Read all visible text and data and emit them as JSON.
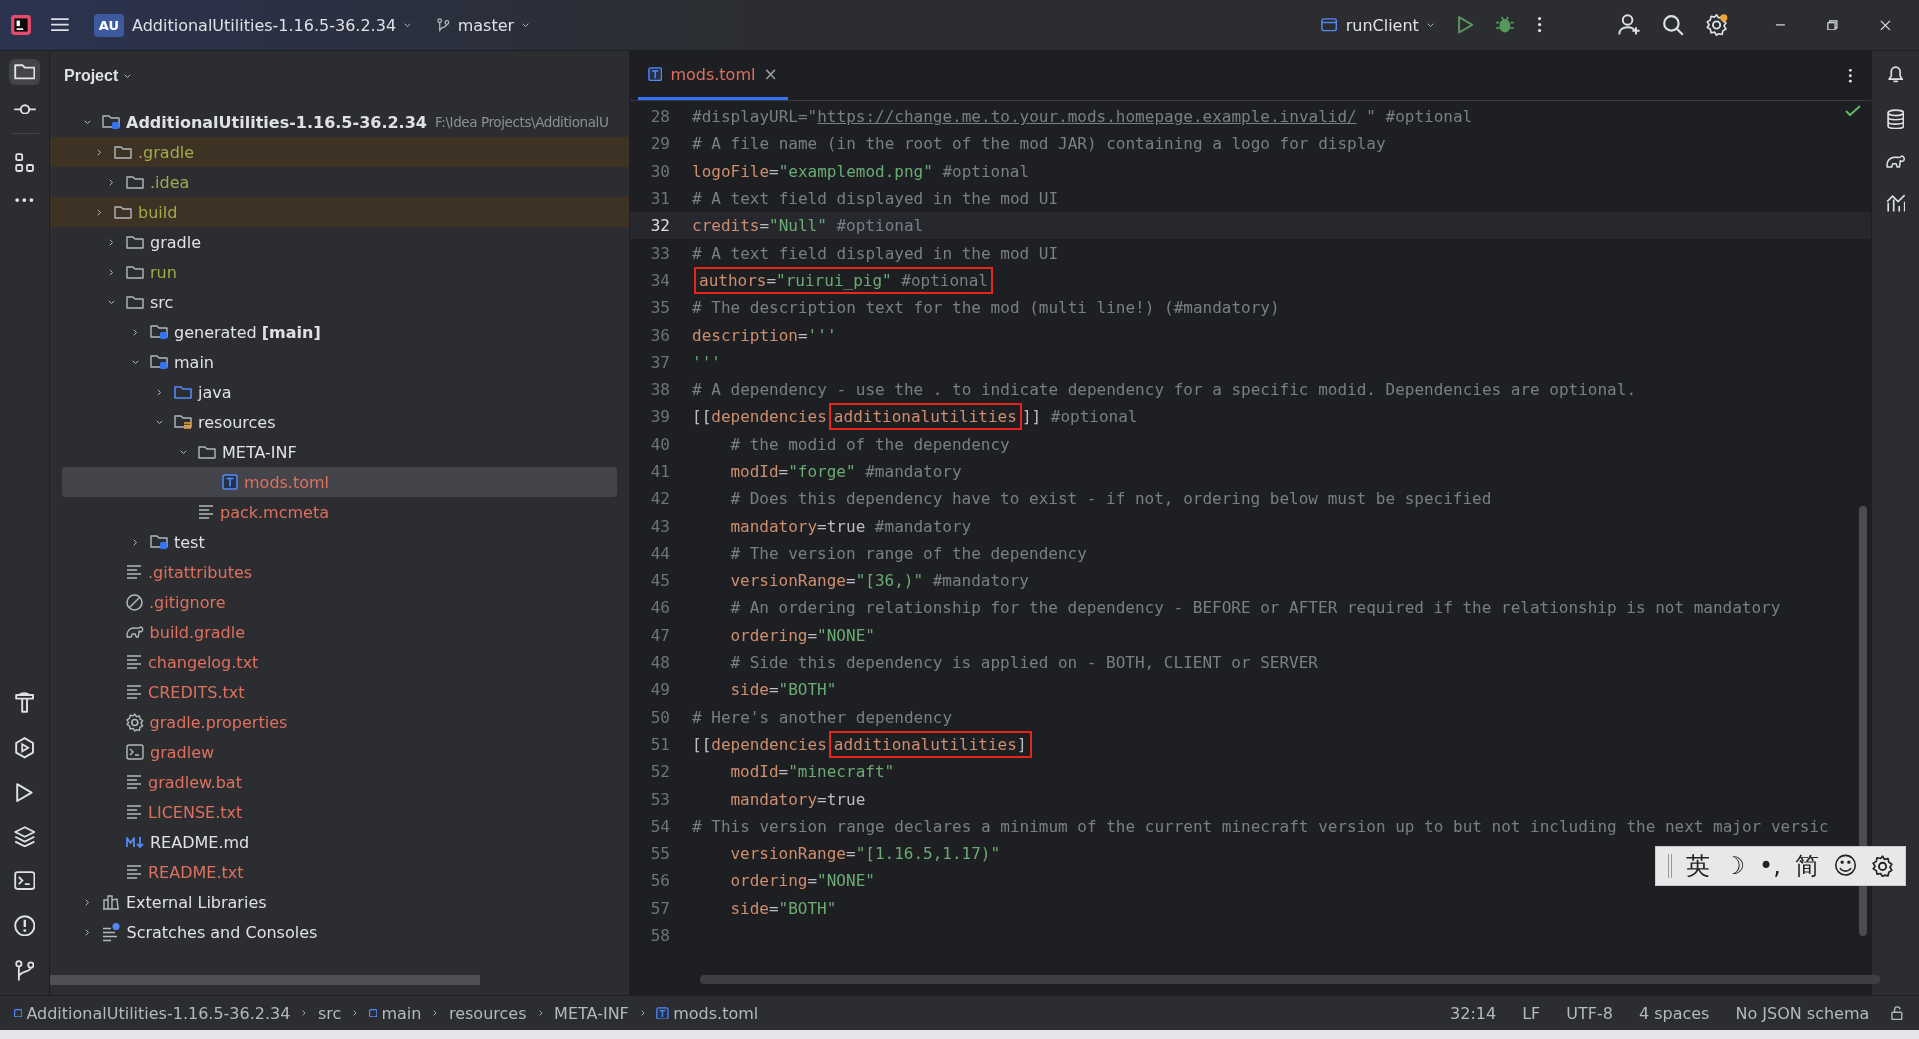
{
  "title_bar": {
    "project_badge": "AU",
    "project": "AdditionalUtilities-1.16.5-36.2.34",
    "branch": "master",
    "run_config": "runClient"
  },
  "project_panel": {
    "title": "Project",
    "tree": [
      {
        "name": "AdditionalUtilities-1.16.5-36.2.34",
        "path": "F:\\Idea Projects\\AdditionalU",
        "kind": "module",
        "color": "#dfe1e5",
        "excluded": false,
        "expanded": true,
        "selected": false,
        "children": [
          {
            "name": ".gradle",
            "kind": "folder",
            "color": "#a4a94b",
            "excluded": true,
            "expanded": false,
            "selected": false
          },
          {
            "name": ".idea",
            "kind": "folder",
            "color": "#a4a94b",
            "excluded": false,
            "expanded": false,
            "selected": false
          },
          {
            "name": "build",
            "kind": "folder",
            "color": "#a4a94b",
            "excluded": true,
            "expanded": false,
            "selected": false
          },
          {
            "name": "gradle",
            "kind": "folder",
            "color": "#dfe1e5",
            "excluded": false,
            "expanded": false,
            "selected": false
          },
          {
            "name": "run",
            "kind": "folder",
            "color": "#a4a94b",
            "excluded": false,
            "expanded": false,
            "selected": false
          },
          {
            "name": "src",
            "kind": "folder",
            "color": "#dfe1e5",
            "excluded": false,
            "expanded": true,
            "selected": false,
            "children": [
              {
                "name": "generated **[main]**",
                "kind": "module",
                "color": "#dfe1e5",
                "excluded": false,
                "expanded": false,
                "selected": false
              },
              {
                "name": "main",
                "kind": "module",
                "color": "#dfe1e5",
                "excluded": false,
                "expanded": true,
                "selected": false,
                "children": [
                  {
                    "name": "java",
                    "kind": "source",
                    "color": "#dfe1e5",
                    "excluded": false,
                    "expanded": false,
                    "selected": false
                  },
                  {
                    "name": "resources",
                    "kind": "resources",
                    "color": "#dfe1e5",
                    "excluded": false,
                    "expanded": true,
                    "selected": false,
                    "children": [
                      {
                        "name": "META-INF",
                        "kind": "folder",
                        "color": "#dfe1e5",
                        "excluded": false,
                        "expanded": true,
                        "selected": false,
                        "children": [
                          {
                            "name": "mods.toml",
                            "kind": "toml",
                            "color": "#e0705e",
                            "excluded": false,
                            "selected": true
                          }
                        ]
                      },
                      {
                        "name": "pack.mcmeta",
                        "kind": "text",
                        "color": "#e0705e",
                        "excluded": false,
                        "selected": false
                      }
                    ]
                  }
                ]
              },
              {
                "name": "test",
                "kind": "module",
                "color": "#dfe1e5",
                "excluded": false,
                "expanded": false,
                "selected": false
              }
            ]
          },
          {
            "name": ".gitattributes",
            "kind": "text",
            "color": "#e0705e",
            "excluded": false,
            "selected": false
          },
          {
            "name": ".gitignore",
            "kind": "ignore",
            "color": "#e0705e",
            "excluded": false,
            "selected": false
          },
          {
            "name": "build.gradle",
            "kind": "elephant",
            "color": "#e0705e",
            "excluded": false,
            "selected": false
          },
          {
            "name": "changelog.txt",
            "kind": "text",
            "color": "#e0705e",
            "excluded": false,
            "selected": false
          },
          {
            "name": "CREDITS.txt",
            "kind": "text",
            "color": "#e0705e",
            "excluded": false,
            "selected": false
          },
          {
            "name": "gradle.properties",
            "kind": "gear",
            "color": "#e0705e",
            "excluded": false,
            "selected": false
          },
          {
            "name": "gradlew",
            "kind": "terminal",
            "color": "#e0705e",
            "excluded": false,
            "selected": false
          },
          {
            "name": "gradlew.bat",
            "kind": "text",
            "color": "#e0705e",
            "excluded": false,
            "selected": false
          },
          {
            "name": "LICENSE.txt",
            "kind": "text",
            "color": "#e0705e",
            "excluded": false,
            "selected": false
          },
          {
            "name": "README.md",
            "kind": "markdown",
            "color": "#dfe1e5",
            "excluded": false,
            "selected": false
          },
          {
            "name": "README.txt",
            "kind": "text",
            "color": "#e0705e",
            "excluded": false,
            "selected": false
          }
        ]
      },
      {
        "name": "External Libraries",
        "kind": "library",
        "color": "#dfe1e5",
        "excluded": false,
        "expanded": false,
        "selected": false
      },
      {
        "name": "Scratches and Consoles",
        "kind": "scratch",
        "color": "#dfe1e5",
        "excluded": false,
        "expanded": false,
        "selected": false
      }
    ]
  },
  "editor": {
    "tabs": [
      {
        "label": "mods.toml",
        "close": "×",
        "selected": true
      }
    ],
    "lines": [
      {
        "number": "28",
        "current": false,
        "indented": false,
        "tokens": [
          {
            "kind": "comment",
            "text": "#displayURL=\""
          },
          {
            "kind": "link",
            "text": "https://change.me.to.your.mods.homepage.example.invalid/"
          },
          {
            "kind": "comment",
            "text": "\" #optional"
          }
        ]
      },
      {
        "number": "29",
        "current": false,
        "indented": false,
        "tokens": [
          {
            "kind": "comment",
            "text": "# A file name (in the root of the mod JAR) containing a logo for display"
          }
        ]
      },
      {
        "number": "30",
        "current": false,
        "indented": false,
        "tokens": [
          {
            "kind": "key",
            "text": "logoFile"
          },
          {
            "kind": "plain",
            "text": "="
          },
          {
            "kind": "string",
            "text": "\"examplemod.png\""
          },
          {
            "kind": "comment",
            "text": "#optional"
          }
        ]
      },
      {
        "number": "31",
        "current": false,
        "indented": false,
        "tokens": [
          {
            "kind": "comment",
            "text": "# A text field displayed in the mod UI"
          }
        ]
      },
      {
        "number": "32",
        "current": true,
        "indented": false,
        "tokens": [
          {
            "kind": "key",
            "text": "credits"
          },
          {
            "kind": "plain",
            "text": "="
          },
          {
            "kind": "string",
            "text": "\"Null\""
          },
          {
            "kind": "comment",
            "text": "#optional"
          }
        ]
      },
      {
        "number": "33",
        "current": false,
        "indented": false,
        "tokens": [
          {
            "kind": "comment",
            "text": "# A text field displayed in the mod UI"
          }
        ]
      },
      {
        "number": "34",
        "current": false,
        "indented": false,
        "tokens": [
          {
            "kind": "box",
            "tokens": [
              {
                "kind": "key",
                "text": "authors"
              },
              {
                "kind": "plain",
                "text": "="
              },
              {
                "kind": "string",
                "text": "\"ruirui_pig\""
              },
              {
                "kind": "comment",
                "text": "#optional"
              }
            ]
          }
        ]
      },
      {
        "number": "35",
        "current": false,
        "indented": false,
        "tokens": [
          {
            "kind": "comment",
            "text": "# The description text for the mod (multi line!) (#mandatory)"
          }
        ]
      },
      {
        "number": "36",
        "current": false,
        "indented": false,
        "tokens": [
          {
            "kind": "key",
            "text": "description"
          },
          {
            "kind": "plain",
            "text": "="
          },
          {
            "kind": "string",
            "text": "'''"
          }
        ]
      },
      {
        "number": "37",
        "current": false,
        "indented": false,
        "tokens": [
          {
            "kind": "string",
            "text": "'''"
          }
        ]
      },
      {
        "number": "38",
        "current": false,
        "indented": false,
        "tokens": [
          {
            "kind": "comment",
            "text": "# A dependency - use the . to indicate dependency for a specific modid. Dependencies are optional."
          }
        ]
      },
      {
        "number": "39",
        "current": false,
        "indented": false,
        "tokens": [
          {
            "kind": "plain",
            "text": "[["
          },
          {
            "kind": "key",
            "text": "dependencies"
          },
          {
            "kind": "box",
            "tokens": [
              {
                "kind": "key",
                "text": "additionalutilities"
              }
            ]
          },
          {
            "kind": "plain",
            "text": "]]"
          },
          {
            "kind": "comment",
            "text": "#optional"
          }
        ]
      },
      {
        "number": "40",
        "current": false,
        "indented": true,
        "tokens": [
          {
            "kind": "comment",
            "text": "# the modid of the dependency"
          }
        ]
      },
      {
        "number": "41",
        "current": false,
        "indented": true,
        "tokens": [
          {
            "kind": "key",
            "text": "modId"
          },
          {
            "kind": "plain",
            "text": "="
          },
          {
            "kind": "string",
            "text": "\"forge\""
          },
          {
            "kind": "comment",
            "text": "#mandatory"
          }
        ]
      },
      {
        "number": "42",
        "current": false,
        "indented": true,
        "tokens": [
          {
            "kind": "comment",
            "text": "# Does this dependency have to exist - if not, ordering below must be specified"
          }
        ]
      },
      {
        "number": "43",
        "current": false,
        "indented": true,
        "tokens": [
          {
            "kind": "key",
            "text": "mandatory"
          },
          {
            "kind": "plain",
            "text": "=true"
          },
          {
            "kind": "comment",
            "text": "#mandatory"
          }
        ]
      },
      {
        "number": "44",
        "current": false,
        "indented": true,
        "tokens": [
          {
            "kind": "comment",
            "text": "# The version range of the dependency"
          }
        ]
      },
      {
        "number": "45",
        "current": false,
        "indented": true,
        "tokens": [
          {
            "kind": "key",
            "text": "versionRange"
          },
          {
            "kind": "plain",
            "text": "="
          },
          {
            "kind": "string",
            "text": "\"[36,)\""
          },
          {
            "kind": "comment",
            "text": "#mandatory"
          }
        ]
      },
      {
        "number": "46",
        "current": false,
        "indented": true,
        "tokens": [
          {
            "kind": "comment",
            "text": "# An ordering relationship for the dependency - BEFORE or AFTER required if the relationship is not mandatory"
          }
        ]
      },
      {
        "number": "47",
        "current": false,
        "indented": true,
        "tokens": [
          {
            "kind": "key",
            "text": "ordering"
          },
          {
            "kind": "plain",
            "text": "="
          },
          {
            "kind": "string",
            "text": "\"NONE\""
          }
        ]
      },
      {
        "number": "48",
        "current": false,
        "indented": true,
        "tokens": [
          {
            "kind": "comment",
            "text": "# Side this dependency is applied on - BOTH, CLIENT or SERVER"
          }
        ]
      },
      {
        "number": "49",
        "current": false,
        "indented": true,
        "tokens": [
          {
            "kind": "key",
            "text": "side"
          },
          {
            "kind": "plain",
            "text": "="
          },
          {
            "kind": "string",
            "text": "\"BOTH\""
          }
        ]
      },
      {
        "number": "50",
        "current": false,
        "indented": false,
        "tokens": [
          {
            "kind": "comment",
            "text": "# Here's another dependency"
          }
        ]
      },
      {
        "number": "51",
        "current": false,
        "indented": false,
        "tokens": [
          {
            "kind": "plain",
            "text": "[["
          },
          {
            "kind": "key",
            "text": "dependencies"
          },
          {
            "kind": "box",
            "tokens": [
              {
                "kind": "key",
                "text": "additionalutilities"
              },
              {
                "kind": "plain",
                "text": "]"
              }
            ]
          }
        ]
      },
      {
        "number": "52",
        "current": false,
        "indented": true,
        "tokens": [
          {
            "kind": "key",
            "text": "modId"
          },
          {
            "kind": "plain",
            "text": "="
          },
          {
            "kind": "string",
            "text": "\"minecraft\""
          }
        ]
      },
      {
        "number": "53",
        "current": false,
        "indented": true,
        "tokens": [
          {
            "kind": "key",
            "text": "mandatory"
          },
          {
            "kind": "plain",
            "text": "=true"
          }
        ]
      },
      {
        "number": "54",
        "current": false,
        "indented": false,
        "tokens": [
          {
            "kind": "comment",
            "text": "# This version range declares a minimum of the current minecraft version up to but not including the next major versic"
          }
        ]
      },
      {
        "number": "55",
        "current": false,
        "indented": true,
        "tokens": [
          {
            "kind": "key",
            "text": "versionRange"
          },
          {
            "kind": "plain",
            "text": "="
          },
          {
            "kind": "string",
            "text": "\"[1.16.5,1.17)\""
          }
        ]
      },
      {
        "number": "56",
        "current": false,
        "indented": true,
        "tokens": [
          {
            "kind": "key",
            "text": "ordering"
          },
          {
            "kind": "plain",
            "text": "="
          },
          {
            "kind": "string",
            "text": "\"NONE\""
          }
        ]
      },
      {
        "number": "57",
        "current": false,
        "indented": true,
        "tokens": [
          {
            "kind": "key",
            "text": "side"
          },
          {
            "kind": "plain",
            "text": "="
          },
          {
            "kind": "string",
            "text": "\"BOTH\""
          }
        ]
      },
      {
        "number": "58",
        "current": false
      }
    ]
  },
  "input_method_bar": {
    "items": [
      "英",
      "☽",
      "•,",
      "简",
      "☺"
    ]
  },
  "status_bar": {
    "breadcrumbs": [
      {
        "text": "AdditionalUtilities-1.16.5-36.2.34",
        "kind": "module"
      },
      {
        "text": "src",
        "kind": "plain"
      },
      {
        "text": "main",
        "kind": "module"
      },
      {
        "text": "resources",
        "kind": "plain"
      },
      {
        "text": "META-INF",
        "kind": "plain"
      },
      {
        "text": "mods.toml",
        "kind": "toml"
      }
    ],
    "items": [
      "32:14",
      "LF",
      "UTF-8",
      "4 spaces",
      "No JSON schema"
    ]
  }
}
